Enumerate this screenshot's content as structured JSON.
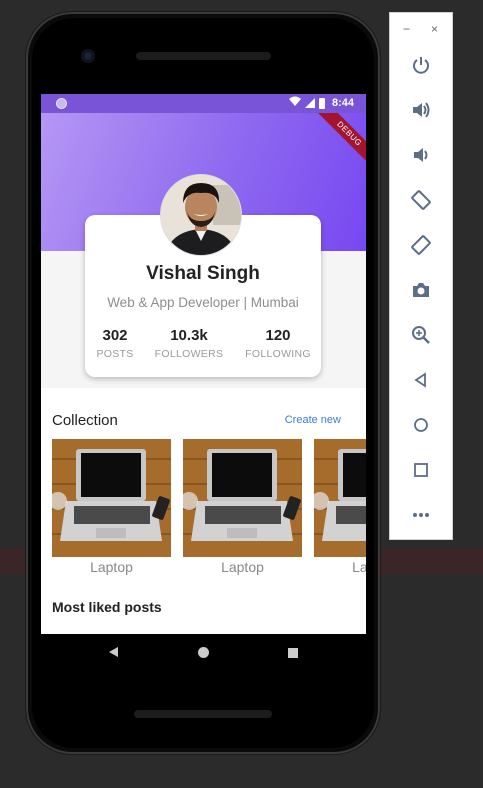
{
  "status_bar": {
    "time": "8:44"
  },
  "debug_banner": "DEBUG",
  "profile": {
    "name": "Vishal Singh",
    "subtitle": "Web & App Developer | Mumbai",
    "stats": [
      {
        "value": "302",
        "label": "POSTS"
      },
      {
        "value": "10.3k",
        "label": "FOLLOWERS"
      },
      {
        "value": "120",
        "label": "FOLLOWING"
      }
    ]
  },
  "collection": {
    "title": "Collection",
    "action": "Create new",
    "items": [
      {
        "label": "Laptop"
      },
      {
        "label": "Laptop"
      },
      {
        "label": "Laptop"
      }
    ]
  },
  "most_liked": {
    "title": "Most liked posts"
  },
  "emulator_controls": {
    "minimize": "−",
    "close": "×",
    "tools": [
      "power-icon",
      "volume-up-icon",
      "volume-down-icon",
      "rotate-left-icon",
      "rotate-right-icon",
      "camera-icon",
      "zoom-icon",
      "back-icon",
      "home-icon",
      "overview-icon",
      "more-icon"
    ]
  },
  "colors": {
    "header_start": "#b597f4",
    "header_end": "#7748f1",
    "status_bar": "#7a54d6",
    "link": "#3d7be0",
    "debug_banner": "#a3152f"
  }
}
